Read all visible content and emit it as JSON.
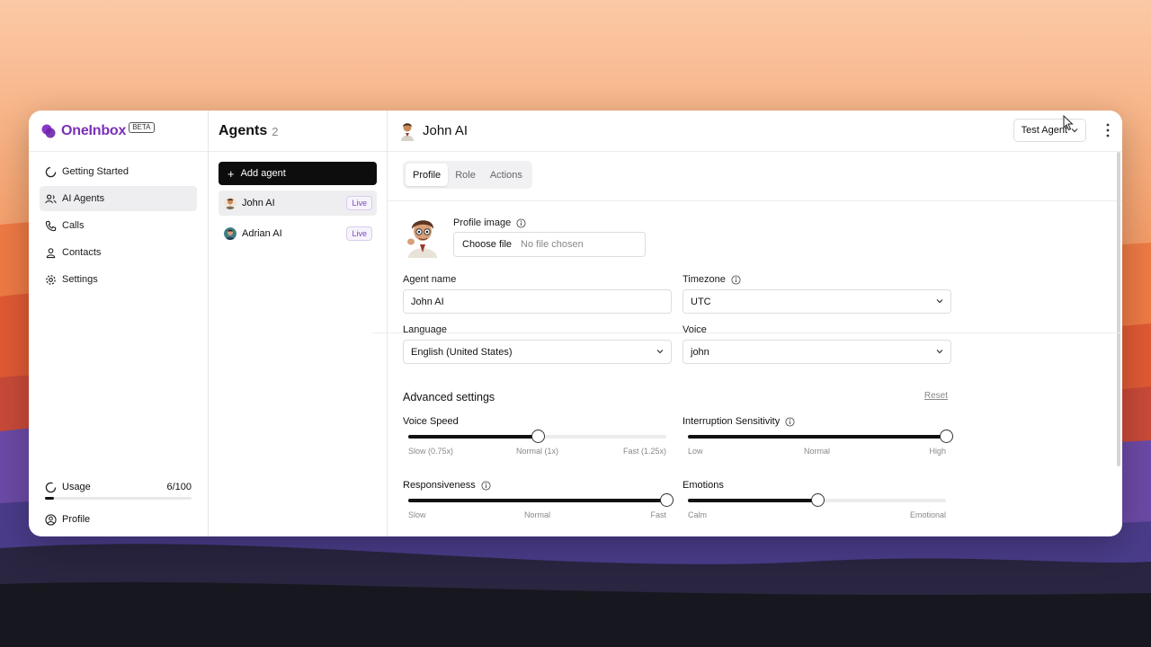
{
  "colors": {
    "brand": "#7b2fb8",
    "live_text": "#7a4bb5",
    "primary_button": "#0d0d0d"
  },
  "sidebar": {
    "brand_name": "OneInbox",
    "beta": "BETA",
    "items": [
      {
        "label": "Getting Started",
        "icon": "loader-icon"
      },
      {
        "label": "AI Agents",
        "icon": "users-icon",
        "active": true
      },
      {
        "label": "Calls",
        "icon": "phone-icon"
      },
      {
        "label": "Contacts",
        "icon": "user-icon"
      },
      {
        "label": "Settings",
        "icon": "gear-icon"
      }
    ],
    "usage": {
      "label": "Usage",
      "count": "6/100",
      "fraction": 0.06
    },
    "profile_label": "Profile"
  },
  "agents": {
    "title": "Agents",
    "count": "2",
    "add_label": "Add agent",
    "list": [
      {
        "name": "John AI",
        "status": "Live",
        "active": true
      },
      {
        "name": "Adrian AI",
        "status": "Live",
        "active": false
      }
    ]
  },
  "main": {
    "title": "John AI",
    "test_agent_label": "Test Agent",
    "tabs": [
      "Profile",
      "Role",
      "Actions"
    ],
    "active_tab": "Profile",
    "profile_image_label": "Profile image",
    "choose_file": "Choose file",
    "no_file": "No file chosen",
    "agent_name_label": "Agent name",
    "agent_name_value": "John AI",
    "timezone_label": "Timezone",
    "timezone_value": "UTC",
    "language_label": "Language",
    "language_value": "English (United States)",
    "voice_label": "Voice",
    "voice_value": "john"
  },
  "advanced": {
    "title": "Advanced settings",
    "reset": "Reset",
    "sliders": [
      {
        "label": "Voice Speed",
        "info": false,
        "value": 0.5,
        "ticks": [
          "Slow (0.75x)",
          "Normal (1x)",
          "Fast (1.25x)"
        ]
      },
      {
        "label": "Interruption Sensitivity",
        "info": true,
        "value": 1.0,
        "ticks": [
          "Low",
          "Normal",
          "High"
        ]
      },
      {
        "label": "Responsiveness",
        "info": true,
        "value": 1.0,
        "ticks": [
          "Slow",
          "Normal",
          "Fast"
        ]
      },
      {
        "label": "Emotions",
        "info": false,
        "value": 0.5,
        "ticks": [
          "Calm",
          "",
          "Emotional"
        ]
      }
    ]
  }
}
